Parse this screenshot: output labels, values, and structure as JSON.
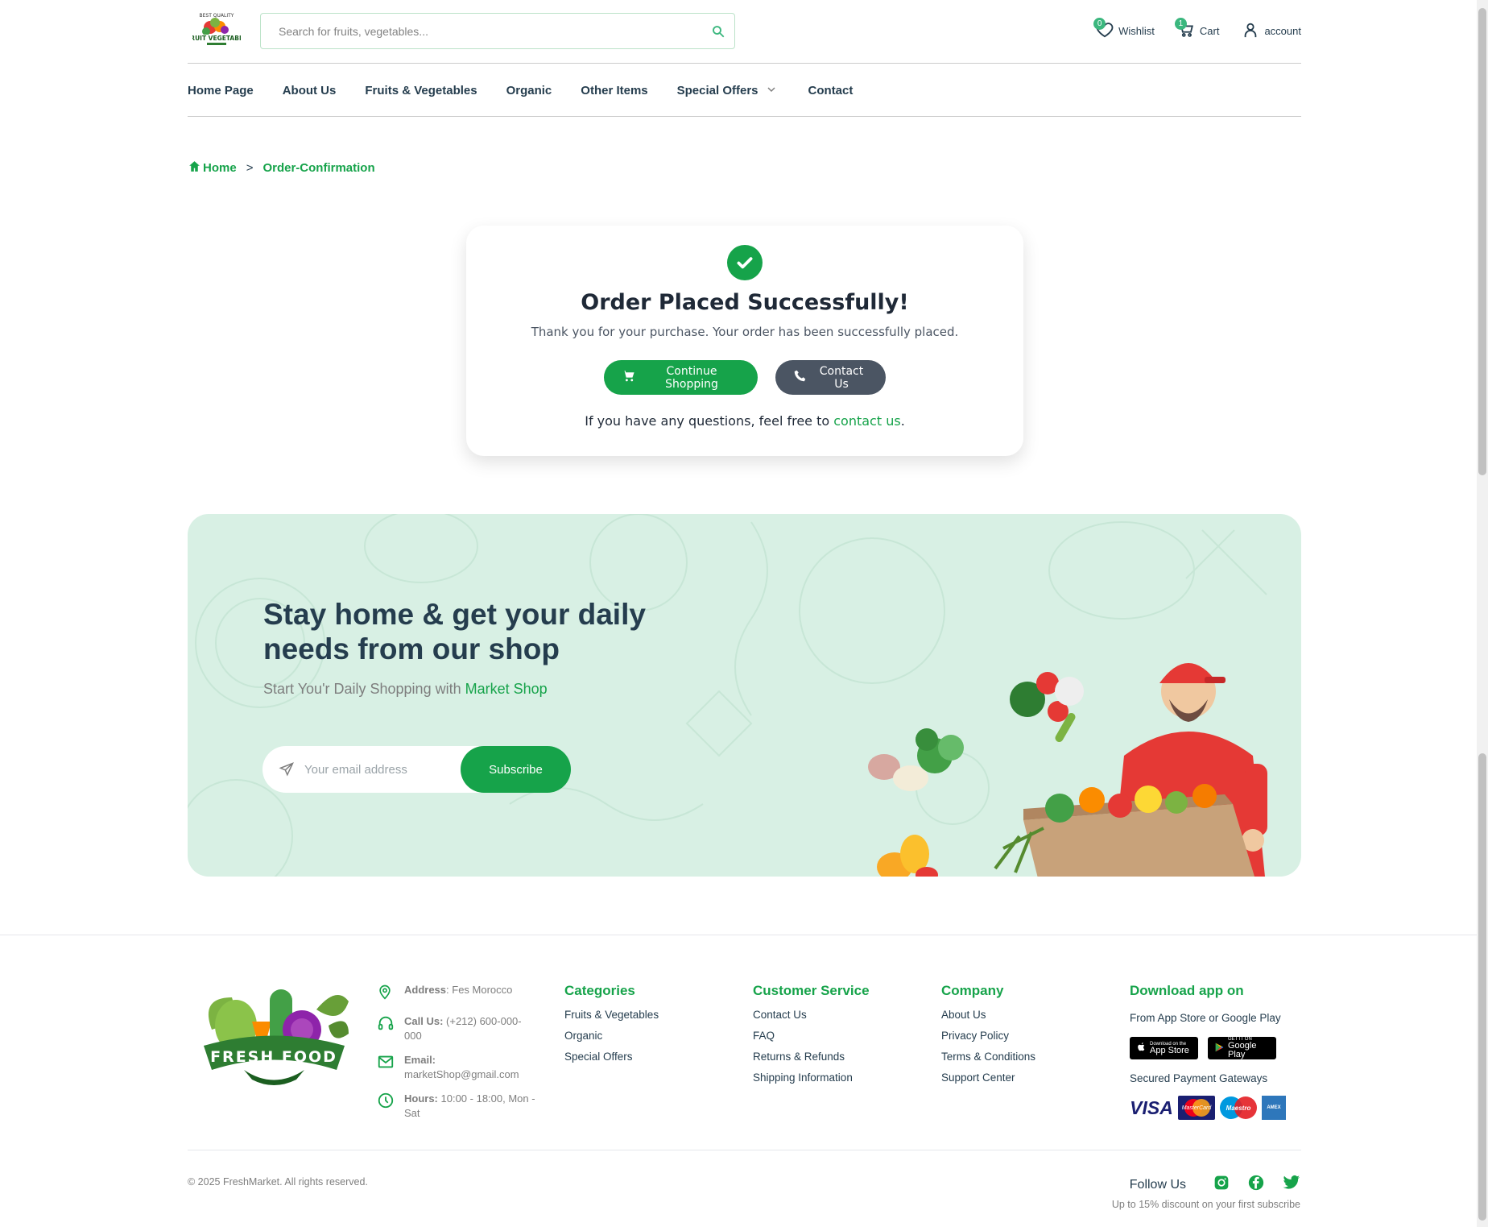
{
  "header": {
    "logo_text": "FRUIT VEGETABLE",
    "search_placeholder": "Search for fruits, vegetables...",
    "wishlist": {
      "label": "Wishlist",
      "count": "0"
    },
    "cart": {
      "label": "Cart",
      "count": "1"
    },
    "account": {
      "label": "account"
    }
  },
  "nav": {
    "items": [
      "Home Page",
      "About Us",
      "Fruits & Vegetables",
      "Organic",
      "Other Items",
      "Special Offers",
      "Contact"
    ]
  },
  "breadcrumb": {
    "home": "Home",
    "separator": ">",
    "current": "Order-Confirmation"
  },
  "confirmation": {
    "title": "Order Placed Successfully!",
    "message": "Thank you for your purchase. Your order has been successfully placed.",
    "continue_label": "Continue Shopping",
    "contact_label": "Contact Us",
    "footnote_prefix": "If you have any questions, feel free to ",
    "footnote_link": "contact us",
    "footnote_suffix": "."
  },
  "banner": {
    "heading": "Stay home & get your daily needs from our shop",
    "sub_prefix": "Start You'r Daily Shopping with ",
    "sub_brand": "Market Shop",
    "email_placeholder": "Your email address",
    "subscribe_label": "Subscribe"
  },
  "footer": {
    "logo_text": "FRESH FOOD",
    "contact": {
      "address_label": "Address",
      "address_value": ": Fes Morocco",
      "call_label": "Call Us:",
      "call_value": " (+212) 600-000-000",
      "email_label": "Email:",
      "email_value": "marketShop@gmail.com",
      "hours_label": "Hours:",
      "hours_value": " 10:00 - 18:00, Mon - Sat"
    },
    "categories": {
      "title": "Categories",
      "links": [
        "Fruits & Vegetables",
        "Organic",
        "Special Offers"
      ]
    },
    "service": {
      "title": "Customer Service",
      "links": [
        "Contact Us",
        "FAQ",
        "Returns & Refunds",
        "Shipping Information"
      ]
    },
    "company": {
      "title": "Company",
      "links": [
        "About Us",
        "Privacy Policy",
        "Terms & Conditions",
        "Support Center"
      ]
    },
    "app": {
      "title": "Download app on",
      "text": "From App Store or Google Play",
      "appstore_small": "Download on the",
      "appstore": "App Store",
      "googleplay_small": "GET IT ON",
      "googleplay": "Google Play",
      "payment_text": "Secured Payment Gateways",
      "payments": [
        "VISA",
        "MasterCard",
        "Maestro",
        "AMEX"
      ]
    },
    "copyright": "© 2025 FreshMarket. All rights reserved.",
    "follow_label": "Follow Us",
    "follow_note": "Up to 15% discount on your first subscribe"
  },
  "colors": {
    "accent": "#16a34a",
    "dark": "#253d4e",
    "banner_bg": "#d8f0e4",
    "gray_button": "#4b5563"
  }
}
